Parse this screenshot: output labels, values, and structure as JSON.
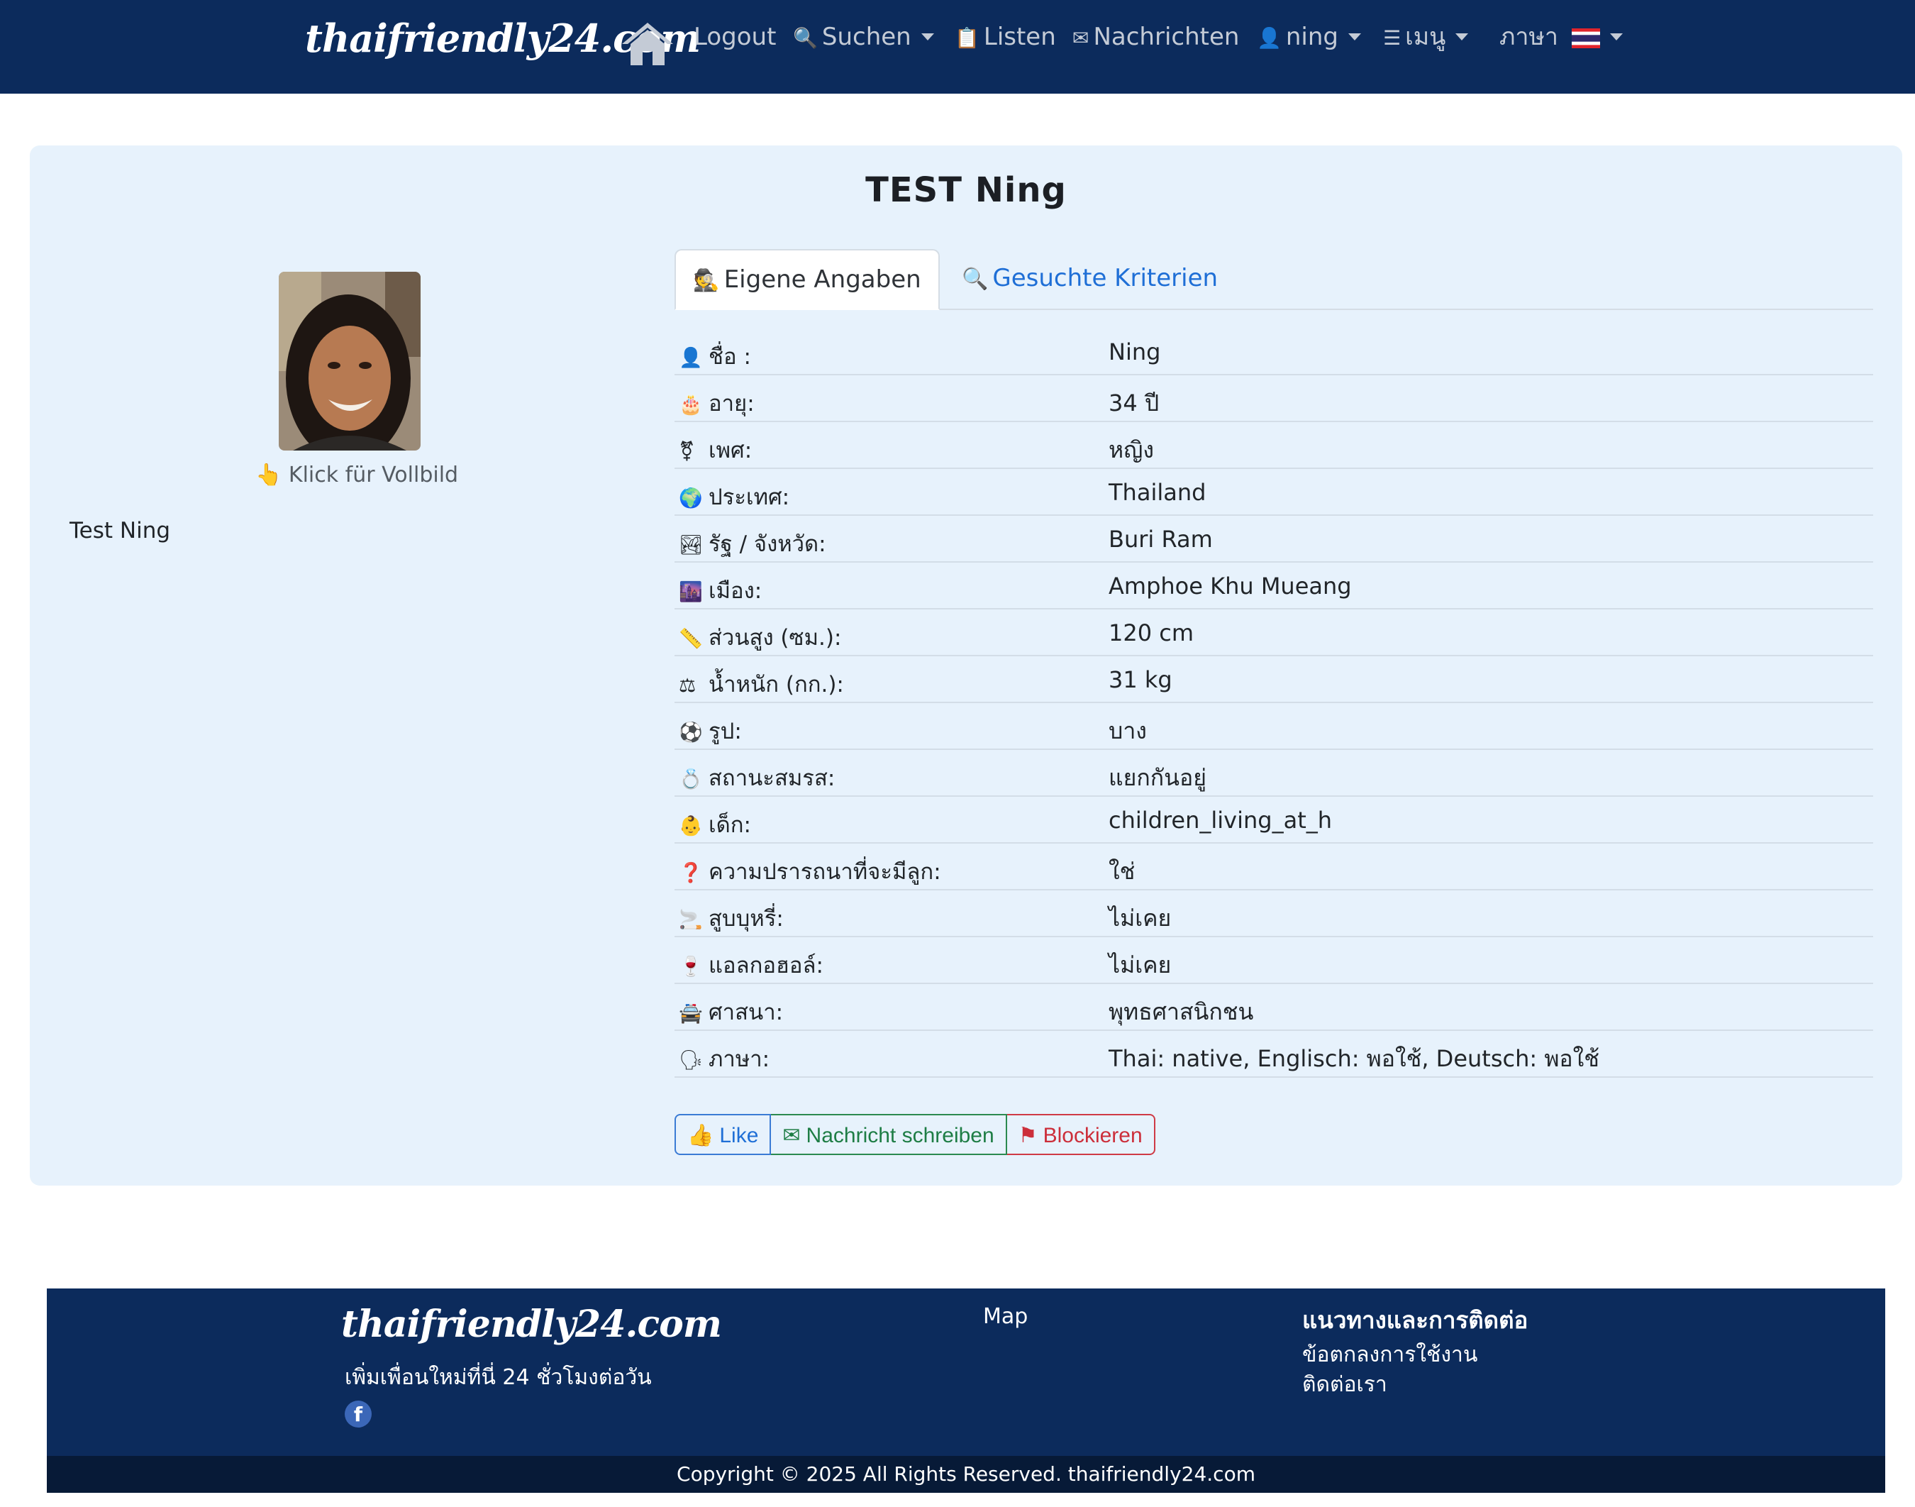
{
  "nav": {
    "brand": "thaifriendly24.com",
    "logout": "Logout",
    "search": "Suchen",
    "lists": "Listen",
    "messages": "Nachrichten",
    "user": "ning",
    "menu": "เมนู",
    "language": "ภาษา"
  },
  "profile": {
    "title": "TEST Ning",
    "fullscreen_hint": "Klick für Vollbild",
    "caption": "Test Ning"
  },
  "tabs": {
    "own": "Eigene Angaben",
    "search_criteria": "Gesuchte Kriterien"
  },
  "details": [
    {
      "icon": "👤",
      "label": "ชื่อ :",
      "value": "Ning"
    },
    {
      "icon": "🎂",
      "label": "อายุ:",
      "value": "34 ปี"
    },
    {
      "icon": "⚧",
      "label": "เพศ:",
      "value": "หญิง"
    },
    {
      "icon": "🌍",
      "label": "ประเทศ:",
      "value": "Thailand"
    },
    {
      "icon": "🏞",
      "label": "รัฐ / จังหวัด:",
      "value": "Buri Ram"
    },
    {
      "icon": "🌆",
      "label": "เมือง:",
      "value": "Amphoe Khu Mueang"
    },
    {
      "icon": "📏",
      "label": "ส่วนสูง (ซม.):",
      "value": "120 cm"
    },
    {
      "icon": "⚖",
      "label": "น้ำหนัก (กก.):",
      "value": "31 kg"
    },
    {
      "icon": "⚽",
      "label": "รูป:",
      "value": "บาง"
    },
    {
      "icon": "💍",
      "label": "สถานะสมรส:",
      "value": "แยกกันอยู่"
    },
    {
      "icon": "👶",
      "label": "เด็ก:",
      "value": "children_living_at_h"
    },
    {
      "icon": "❓",
      "label": "ความปรารถนาที่จะมีลูก:",
      "value": "ใช่"
    },
    {
      "icon": "🚬",
      "label": "สูบบุหรี่:",
      "value": "ไม่เคย"
    },
    {
      "icon": "🍷",
      "label": "แอลกอฮอล์:",
      "value": "ไม่เคย"
    },
    {
      "icon": "🚔",
      "label": "ศาสนา:",
      "value": "พุทธศาสนิกชน"
    },
    {
      "icon": "🗣",
      "label": "ภาษา:",
      "value": "Thai: native, Englisch: พอใช้, Deutsch: พอใช้"
    }
  ],
  "actions": {
    "like": "Like",
    "message": "Nachricht schreiben",
    "block": "Blockieren"
  },
  "footer": {
    "brand": "thaifriendly24.com",
    "tagline": "เพิ่มเพื่อนใหม่ที่นี่ 24 ชั่วโมงต่อวัน",
    "map": "Map",
    "heading": "แนวทางและการติดต่อ",
    "terms": "ข้อตกลงการใช้งาน",
    "contact": "ติดต่อเรา",
    "copyright": "Copyright © 2025 All Rights Reserved. thaifriendly24.com"
  },
  "colors": {
    "navbar": "#0c2b5c",
    "card": "#e7f2fc",
    "like": "#1f6fd6",
    "message": "#1e7d45",
    "block": "#cc2e3a"
  }
}
